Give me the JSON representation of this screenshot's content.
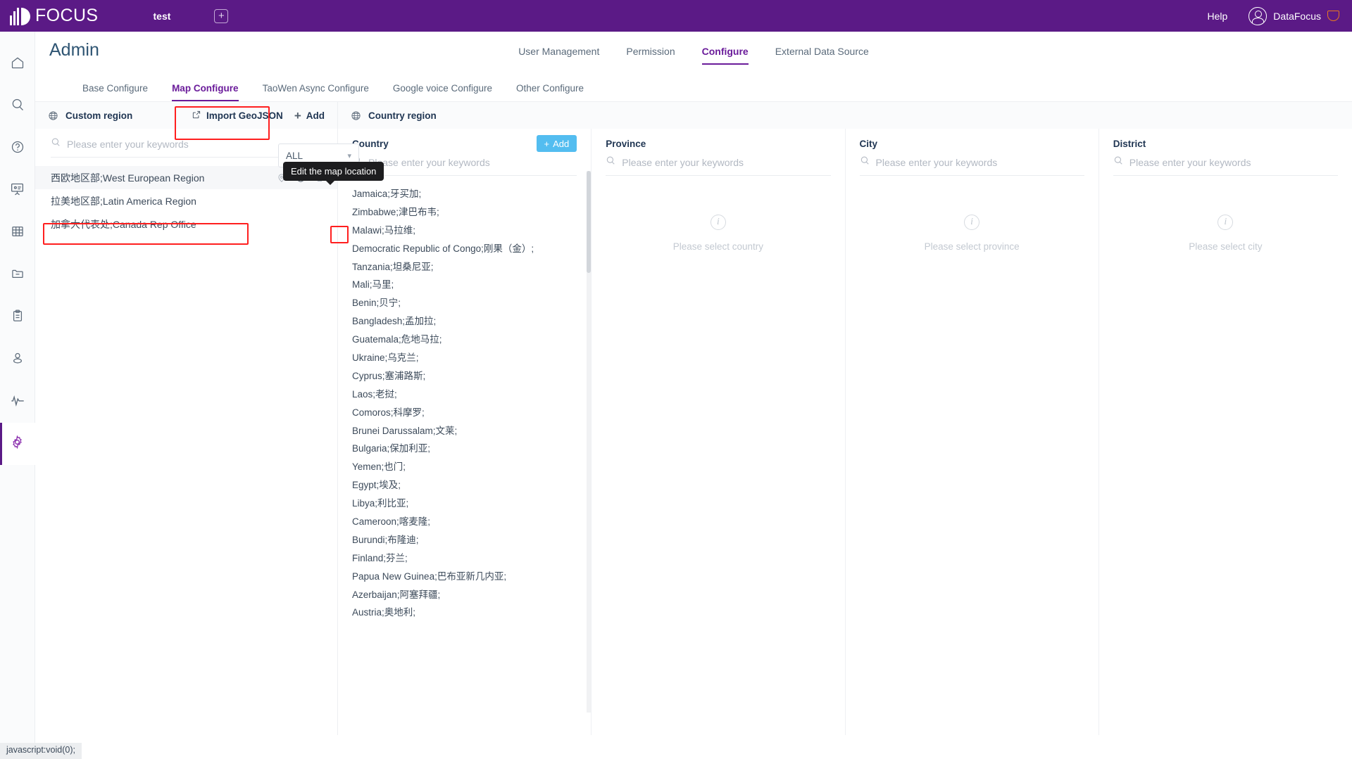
{
  "header": {
    "brand": "FOCUS",
    "tab_label": "test",
    "add_tab_icon": "plus-icon",
    "help": "Help",
    "user": "DataFocus",
    "avatar_icon": "user-avatar-icon",
    "badge_icon": "caret-badge-icon"
  },
  "rail": {
    "items": [
      {
        "name": "home",
        "icon": "home-icon"
      },
      {
        "name": "search",
        "icon": "search-icon"
      },
      {
        "name": "help",
        "icon": "question-circle-icon"
      },
      {
        "name": "board",
        "icon": "presentation-icon"
      },
      {
        "name": "table",
        "icon": "grid-table-icon"
      },
      {
        "name": "folder",
        "icon": "folder-minus-icon"
      },
      {
        "name": "clipboard",
        "icon": "clipboard-icon"
      },
      {
        "name": "user",
        "icon": "user-icon"
      },
      {
        "name": "monitor",
        "icon": "pulse-icon"
      },
      {
        "name": "settings",
        "icon": "gear-icon"
      }
    ]
  },
  "page": {
    "title": "Admin",
    "main_tabs": [
      {
        "label": "User Management",
        "active": false
      },
      {
        "label": "Permission",
        "active": false
      },
      {
        "label": "Configure",
        "active": true
      },
      {
        "label": "External Data Source",
        "active": false
      }
    ],
    "sub_tabs": [
      {
        "label": "Base Configure",
        "active": false
      },
      {
        "label": "Map Configure",
        "active": true
      },
      {
        "label": "TaoWen Async Configure",
        "active": false
      },
      {
        "label": "Google voice Configure",
        "active": false
      },
      {
        "label": "Other Configure",
        "active": false
      }
    ]
  },
  "custom_region": {
    "title": "Custom region",
    "title_icon": "globe-icon",
    "import_label": "Import GeoJSON",
    "import_icon": "import-icon",
    "add_label": "Add",
    "add_icon": "plus-icon",
    "search_placeholder": "Please enter your keywords",
    "search_value": "",
    "search_icon": "search-icon",
    "filter_select_value": "ALL",
    "filter_chevron_icon": "chevron-down-icon",
    "tooltip": "Edit the map location",
    "row_icons": [
      "location-pin-icon",
      "map-globe-icon",
      "trash-icon"
    ],
    "items": [
      {
        "label": "西欧地区部;West European Region",
        "selected": true
      },
      {
        "label": "拉美地区部;Latin America Region",
        "selected": false
      },
      {
        "label": "加拿大代表处;Canada Rep Office",
        "selected": false
      }
    ]
  },
  "country_region": {
    "title": "Country region",
    "title_icon": "globe-icon",
    "columns": [
      {
        "title": "Country",
        "search_placeholder": "Please enter your keywords",
        "search_value": "",
        "has_add": true,
        "add_label": "Add",
        "add_icon": "plus-icon",
        "items": [
          "Jamaica;牙买加;",
          "Zimbabwe;津巴布韦;",
          "Malawi;马拉维;",
          "Democratic Republic of Congo;刚果（金）;",
          "Tanzania;坦桑尼亚;",
          "Mali;马里;",
          "Benin;贝宁;",
          "Bangladesh;孟加拉;",
          "Guatemala;危地马拉;",
          "Ukraine;乌克兰;",
          "Cyprus;塞浦路斯;",
          "Laos;老挝;",
          "Comoros;科摩罗;",
          "Brunei Darussalam;文莱;",
          "Bulgaria;保加利亚;",
          "Yemen;也门;",
          "Egypt;埃及;",
          "Libya;利比亚;",
          "Cameroon;喀麦隆;",
          "Burundi;布隆迪;",
          "Finland;芬兰;",
          "Papua New Guinea;巴布亚新几内亚;",
          "Azerbaijan;阿塞拜疆;",
          "Austria;奥地利;"
        ],
        "empty_text": "",
        "empty_icon": ""
      },
      {
        "title": "Province",
        "search_placeholder": "Please enter your keywords",
        "search_value": "",
        "has_add": false,
        "items": [],
        "empty_text": "Please select country",
        "empty_icon": "info-circle-icon"
      },
      {
        "title": "City",
        "search_placeholder": "Please enter your keywords",
        "search_value": "",
        "has_add": false,
        "items": [],
        "empty_text": "Please select province",
        "empty_icon": "info-circle-icon"
      },
      {
        "title": "District",
        "search_placeholder": "Please enter your keywords",
        "search_value": "",
        "has_add": false,
        "items": [],
        "empty_text": "Please select city",
        "empty_icon": "info-circle-icon"
      }
    ]
  },
  "status_bar": {
    "text": "javascript:void(0);"
  },
  "colors": {
    "brand_purple": "#5B1A86",
    "accent_purple": "#6a1b9a",
    "add_blue": "#53bdf0",
    "highlight_red": "#ff1f1f",
    "title_blue": "#2f5573"
  }
}
